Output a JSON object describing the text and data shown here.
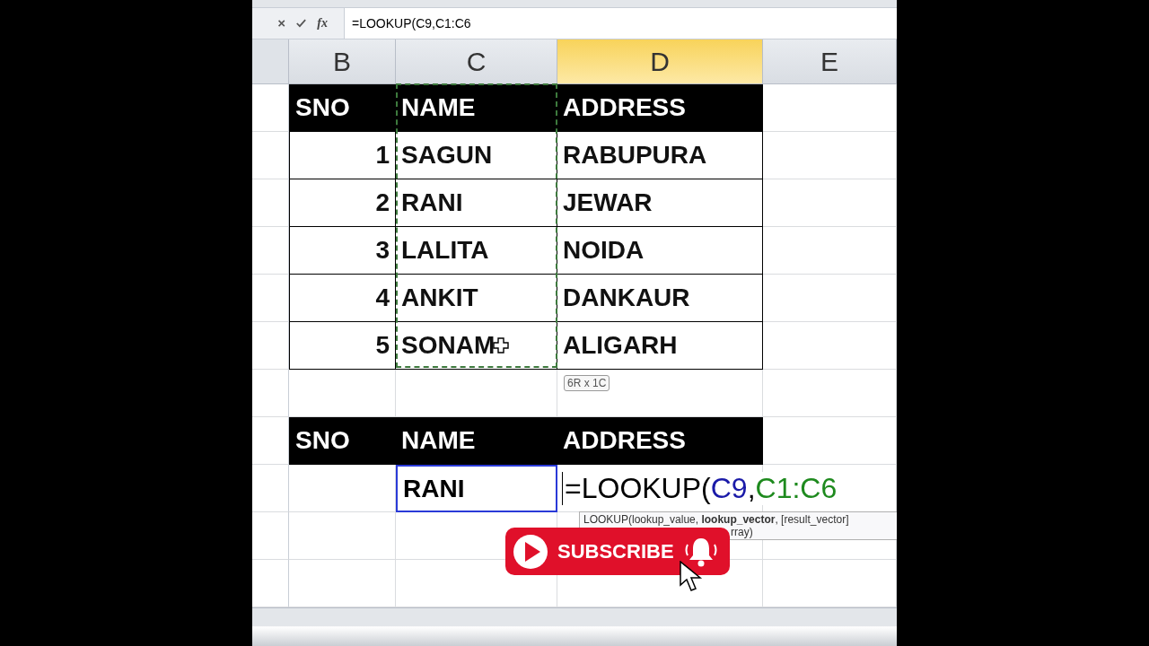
{
  "formula_bar": {
    "function_label": "fx",
    "formula": "=LOOKUP(C9,C1:C6"
  },
  "columns": [
    {
      "label": "B",
      "selected": false
    },
    {
      "label": "C",
      "selected": false
    },
    {
      "label": "D",
      "selected": true
    },
    {
      "label": "E",
      "selected": false
    }
  ],
  "table_1": {
    "headers": [
      "SNO",
      "NAME",
      "ADDRESS"
    ],
    "rows": [
      [
        "1",
        "SAGUN",
        "RABUPURA"
      ],
      [
        "2",
        "RANI",
        "JEWAR"
      ],
      [
        "3",
        "LALITA",
        "NOIDA"
      ],
      [
        "4",
        "ANKIT",
        "DANKAUR"
      ],
      [
        "5",
        "SONAM",
        "ALIGARH"
      ]
    ]
  },
  "range_tooltip": "6R x 1C",
  "table_2": {
    "headers": [
      "SNO",
      "NAME",
      "ADDRESS"
    ],
    "row": {
      "name": "RANI",
      "name_referenced": true,
      "formula_parts": [
        {
          "text": "=LOOKUP(",
          "color": "#000000"
        },
        {
          "text": "C9",
          "color": "#1a1aa8"
        },
        {
          "text": ",",
          "color": "#000000"
        },
        {
          "text": "C1:C6",
          "color": "#1e8a1e"
        }
      ]
    }
  },
  "function_tooltip": {
    "line_1": "LOOKUP(lookup_value, **lookup_vector**, [result_vector]",
    "line_2": "rray)"
  },
  "subscribe_button": {
    "label": "SUBSCRIBE"
  }
}
